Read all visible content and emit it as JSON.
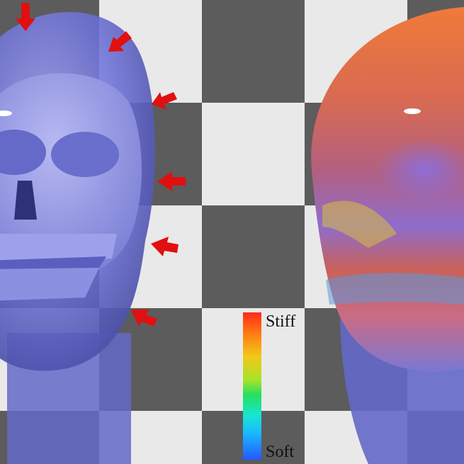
{
  "legend": {
    "top_label": "Stiff",
    "bottom_label": "Soft",
    "colors": [
      "#ff2a1a",
      "#ff7a14",
      "#f2c819",
      "#a6e32a",
      "#24e060",
      "#18e6d2",
      "#1ab8ff",
      "#2458ff"
    ]
  },
  "scene": {
    "left_model_color": "#6f73d8",
    "right_model_colors": [
      "#e46c3e",
      "#c35b72",
      "#8e69c8",
      "#5c94d8"
    ],
    "arrow_color": "#e01010"
  }
}
